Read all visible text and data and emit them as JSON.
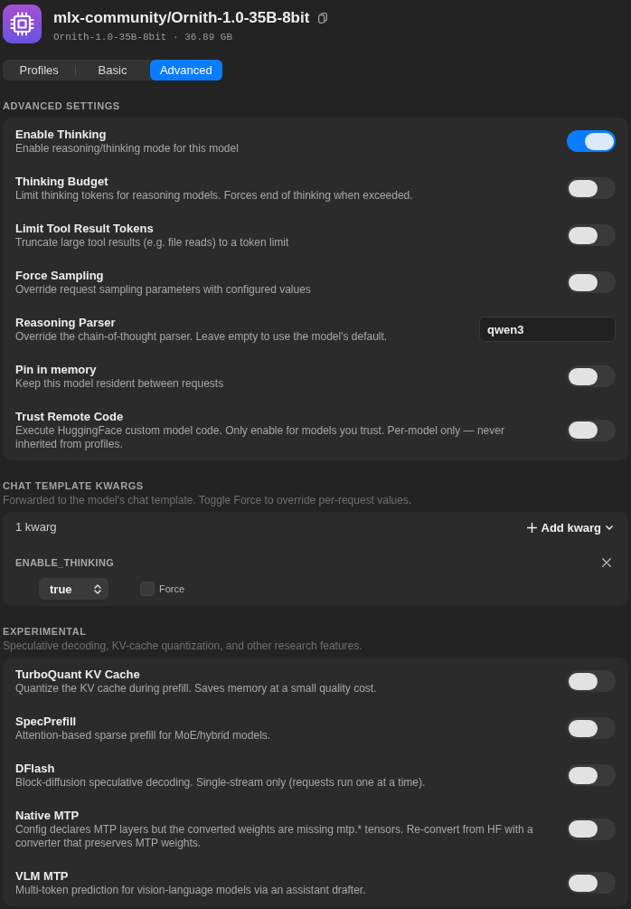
{
  "header": {
    "title": "mlx-community/Ornith-1.0-35B-8bit",
    "subtitle": "Ornith-1.0-35B-8bit · 36.89 GB"
  },
  "tabs": [
    {
      "label": "Profiles",
      "selected": false
    },
    {
      "label": "Basic",
      "selected": false
    },
    {
      "label": "Advanced",
      "selected": true
    }
  ],
  "advanced_settings": {
    "heading": "ADVANCED SETTINGS",
    "rows": [
      {
        "kind": "toggle",
        "title": "Enable Thinking",
        "description": "Enable reasoning/thinking mode for this model",
        "on": true
      },
      {
        "kind": "toggle",
        "title": "Thinking Budget",
        "description": "Limit thinking tokens for reasoning models. Forces end of thinking when exceeded.",
        "on": false
      },
      {
        "kind": "toggle",
        "title": "Limit Tool Result Tokens",
        "description": "Truncate large tool results (e.g. file reads) to a token limit",
        "on": false
      },
      {
        "kind": "toggle",
        "title": "Force Sampling",
        "description": "Override request sampling parameters with configured values",
        "on": false
      },
      {
        "kind": "text",
        "title": "Reasoning Parser",
        "description": "Override the chain-of-thought parser. Leave empty to use the model's default.",
        "value": "qwen3"
      },
      {
        "kind": "toggle",
        "title": "Pin in memory",
        "description": "Keep this model resident between requests",
        "on": false
      },
      {
        "kind": "toggle",
        "title": "Trust Remote Code",
        "description": "Execute HuggingFace custom model code. Only enable for models you trust. Per-model only — never inherited from profiles.",
        "on": false
      }
    ]
  },
  "chat_template_kwargs": {
    "heading": "CHAT TEMPLATE KWARGS",
    "description": "Forwarded to the model's chat template. Toggle Force to override per-request values.",
    "count": "1 kwarg",
    "add_button": "Add kwarg",
    "kwargs": [
      {
        "name": "ENABLE_THINKING",
        "value": "true",
        "force": {
          "label": "Force",
          "checked": false
        }
      }
    ]
  },
  "experimental": {
    "heading": "EXPERIMENTAL",
    "description": "Speculative decoding, KV-cache quantization, and other research features.",
    "rows": [
      {
        "kind": "toggle",
        "title": "TurboQuant KV Cache",
        "description": "Quantize the KV cache during prefill. Saves memory at a small quality cost.",
        "on": false
      },
      {
        "kind": "toggle",
        "title": "SpecPrefill",
        "description": "Attention-based sparse prefill for MoE/hybrid models.",
        "on": false
      },
      {
        "kind": "toggle",
        "title": "DFlash",
        "description": "Block-diffusion speculative decoding. Single-stream only (requests run one at a time).",
        "on": false
      },
      {
        "kind": "toggle",
        "title": "Native MTP",
        "description": "Config declares MTP layers but the converted weights are missing mtp.* tensors. Re-convert from HF with a converter that preserves MTP weights.",
        "on": false
      },
      {
        "kind": "toggle",
        "title": "VLM MTP",
        "description": "Multi-token prediction for vision-language models via an assistant drafter.",
        "on": false
      }
    ]
  }
}
